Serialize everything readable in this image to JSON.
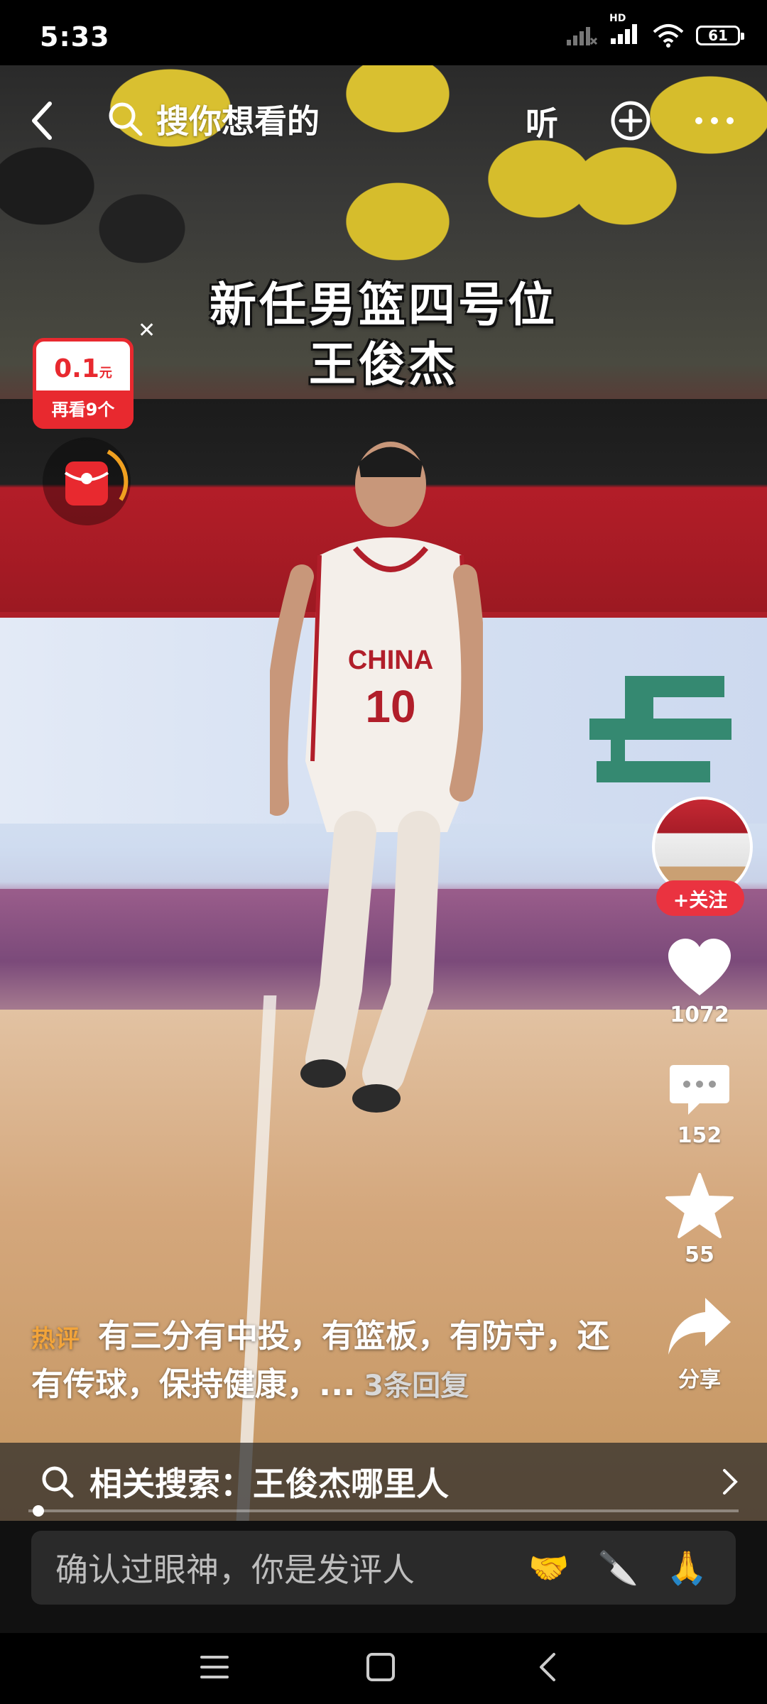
{
  "status_bar": {
    "time": "5:33",
    "battery": "61",
    "network": "HD"
  },
  "top_bar": {
    "search_placeholder": "搜你想看的",
    "listen_label": "听"
  },
  "video_title": {
    "line1": "新任男篮四号位",
    "line2": "王俊杰"
  },
  "reward": {
    "amount": "0.1",
    "unit": "元",
    "remaining": "再看9个"
  },
  "jersey": {
    "team": "CHINA",
    "number": "10"
  },
  "right_rail": {
    "follow_label": "+关注",
    "likes": "1072",
    "comments": "152",
    "favorites": "55",
    "share_label": "分享"
  },
  "hot_comment": {
    "tag": "热评",
    "text": "有三分有中投，有篮板，有防守，还有传球，保持健康，...",
    "replies": "3条回复"
  },
  "related_search": {
    "text": "相关搜索：王俊杰哪里人"
  },
  "comment_input": {
    "placeholder": "确认过眼神，你是发评人",
    "emojis": [
      "🤝",
      "🔪",
      "🙏"
    ]
  },
  "colors": {
    "accent_red": "#e8292f",
    "follow_red": "#ea3340",
    "hot_orange": "#f2a43a"
  }
}
